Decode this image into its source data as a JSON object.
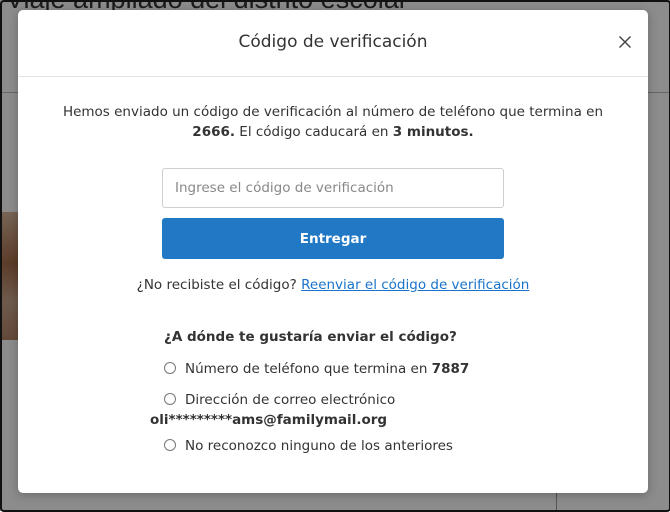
{
  "background": {
    "title": "Viaje ampliado del distrito escolar"
  },
  "modal": {
    "title": "Código de verificación",
    "close_icon": "close-icon",
    "message_prefix": "Hemos enviado un código de verificación al número de teléfono que termina en ",
    "phone_ending": "2666.",
    "message_middle": " El código caducará en ",
    "expiry": "3 minutos.",
    "code_input": {
      "placeholder": "Ingrese el código de verificación",
      "value": ""
    },
    "submit_label": "Entregar",
    "resend_prompt": "¿No recibiste el código? ",
    "resend_link": "Reenviar el código de verificación",
    "question": "¿A dónde te gustaría enviar el código?",
    "options": [
      {
        "label": "Número de teléfono que termina en ",
        "bold": "7887"
      },
      {
        "label": "Dirección de correo electrónico",
        "bold": "oli*********ams@familymail.org"
      },
      {
        "label": "No reconozco ninguno de los anteriores"
      }
    ]
  },
  "colors": {
    "accent": "#2178c4",
    "link": "#1a73c9"
  }
}
